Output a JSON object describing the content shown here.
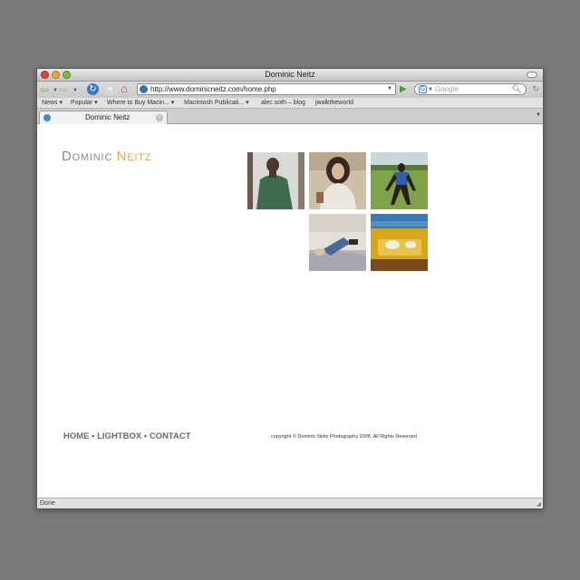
{
  "window": {
    "title": "Dominic Neitz"
  },
  "toolbar": {
    "url": "http://www.dominicneitz.com/home.php",
    "search_placeholder": "Google"
  },
  "bookmarks": [
    {
      "label": "News ▾"
    },
    {
      "label": "Popular ▾"
    },
    {
      "label": "Where to Buy Macin... ▾"
    },
    {
      "label": "Macintosh Publicati... ▾"
    },
    {
      "label": "alec soth – blog"
    },
    {
      "label": "jwalktheworld"
    }
  ],
  "tab": {
    "label": "Dominic Neitz"
  },
  "site": {
    "logo_first": "Dominic",
    "logo_last": "Neitz",
    "thumbnails": [
      {
        "icon": "man-portrait-photo"
      },
      {
        "icon": "woman-portrait-photo"
      },
      {
        "icon": "boy-in-field-photo"
      },
      {
        "icon": "reclining-figure-photo"
      },
      {
        "icon": "yellow-table-photo"
      }
    ],
    "nav": {
      "home": "HOME",
      "lightbox": "LIGHTBOX",
      "contact": "CONTACT",
      "separator": "•"
    },
    "copyright": "copyright © Dominic Neitz Photography 2008, All Rights Reserved"
  },
  "status": {
    "text": "Done"
  }
}
